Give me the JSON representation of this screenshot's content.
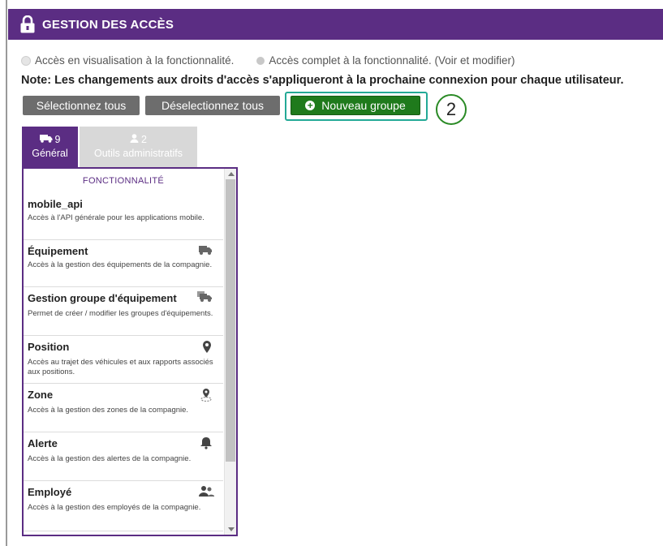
{
  "header": {
    "title": "GESTION DES ACCÈS",
    "icon": "lock-icon"
  },
  "legend": {
    "view": "Accès en visualisation à la fonctionnalité.",
    "full": "Accès complet à la fonctionnalité. (Voir et modifier)"
  },
  "note": "Note: Les changements aux droits d'accès s'appliqueront à la prochaine connexion pour chaque utilisateur.",
  "buttons": {
    "select_all": "Sélectionnez tous",
    "deselect_all": "Déselectionnez tous",
    "new_group": "Nouveau groupe"
  },
  "step_marker": "2",
  "tabs": [
    {
      "count": "9",
      "label": "Général",
      "icon": "truck-icon",
      "active": true
    },
    {
      "count": "2",
      "label": "Outils administratifs",
      "icon": "user-icon",
      "active": false
    }
  ],
  "panel": {
    "header": "FONCTIONNALITÉ",
    "items": [
      {
        "name": "mobile_api",
        "desc": "Accès à l'API générale pour les applications mobile.",
        "icon": ""
      },
      {
        "name": "Équipement",
        "desc": "Accès à la gestion des équipements de la compagnie.",
        "icon": "truck-icon"
      },
      {
        "name": "Gestion groupe d'équipement",
        "desc": "Permet de créer / modifier les groupes d'équipements.",
        "icon": "trucks-icon"
      },
      {
        "name": "Position",
        "desc": "Accès au trajet des véhicules et aux rapports associés aux positions.",
        "icon": "map-pin-icon"
      },
      {
        "name": "Zone",
        "desc": "Accès à la gestion des zones de la compagnie.",
        "icon": "zone-pin-icon"
      },
      {
        "name": "Alerte",
        "desc": "Accès à la gestion des alertes de la compagnie.",
        "icon": "bell-icon"
      },
      {
        "name": "Employé",
        "desc": "Accès à la gestion des employés de la compagnie.",
        "icon": "users-icon"
      }
    ]
  },
  "colors": {
    "header": "#5b2d83",
    "primary_button": "#1f7a1c",
    "secondary_button": "#6d6d6d",
    "highlight": "#23a996"
  }
}
